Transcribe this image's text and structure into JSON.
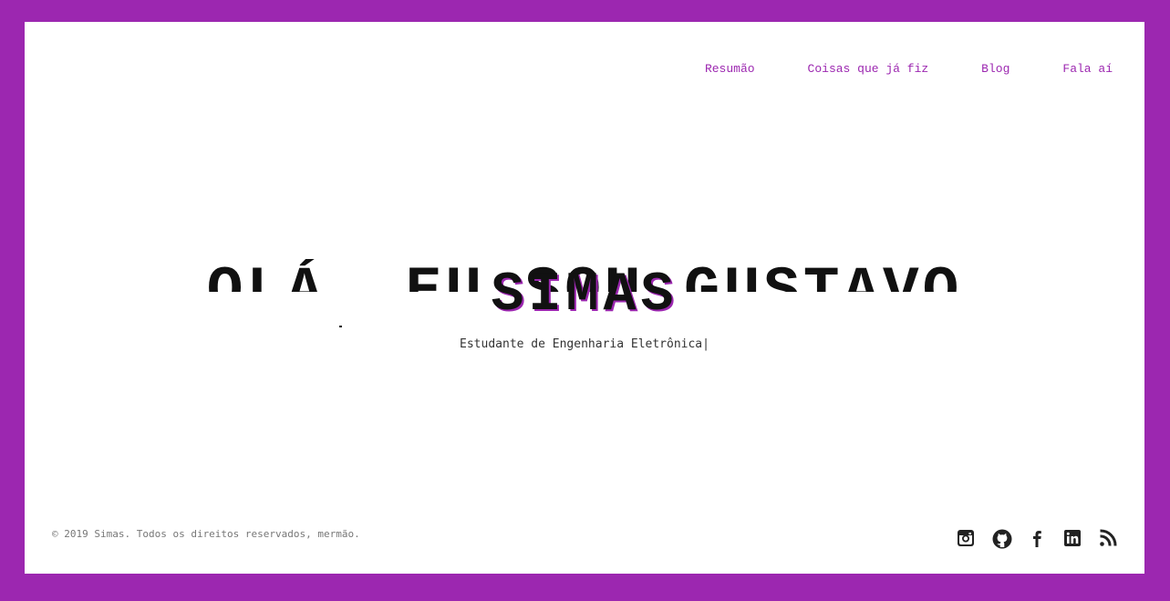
{
  "nav": {
    "items": [
      "Resumão",
      "Coisas que já fiz",
      "Blog",
      "Fala aí"
    ]
  },
  "hero": {
    "line1": "OLÁ, EU SOU GUSTAVO",
    "line2": "SIMAS",
    "subtitle": "Estudante de Engenharia Eletrônica",
    "cursor": "|"
  },
  "footer": {
    "copyright": "© 2019 Simas. Todos os direitos reservados, mermão."
  },
  "socials": [
    "instagram-icon",
    "github-icon",
    "facebook-icon",
    "linkedin-icon",
    "rss-icon"
  ],
  "colors": {
    "accent": "#9c27b0",
    "text": "#111111"
  }
}
